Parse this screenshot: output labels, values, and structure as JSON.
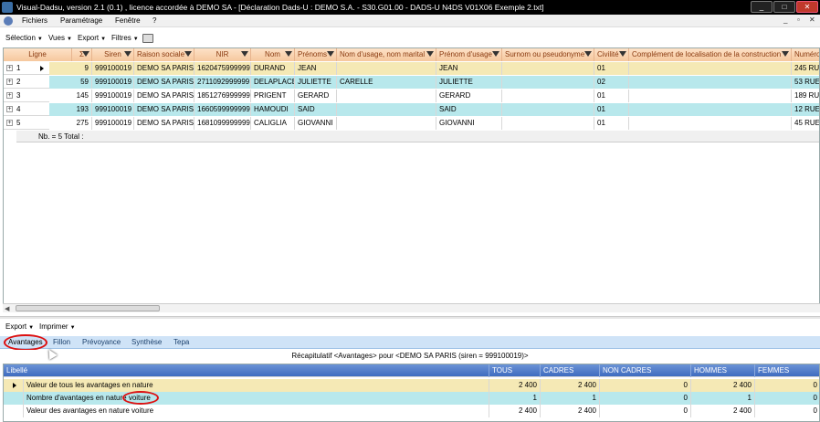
{
  "window": {
    "title": "Visual-Dadsu, version 2.1 (0.1) , licence accordée à DEMO SA - [Déclaration Dads-U : DEMO S.A. - S30.G01.00 - DADS-U N4DS V01X06 Exemple 2.txt]",
    "minimize": "_",
    "maximize": "□",
    "close": "✕"
  },
  "menu": {
    "items": [
      "Fichiers",
      "Paramétrage",
      "Fenêtre",
      "?"
    ],
    "child_controls": [
      "_",
      "▫",
      "✕"
    ]
  },
  "toolbar": {
    "items": [
      "Sélection",
      "Vues",
      "Export",
      "Filtres"
    ]
  },
  "grid": {
    "columns": [
      "Ligne",
      "Σ",
      "Siren",
      "Raison sociale",
      "NIR",
      "Nom",
      "Prénoms",
      "Nom d'usage, nom marital",
      "Prénom d'usage",
      "Surnom ou pseudonyme",
      "Civilité",
      "Complément de localisation de la construction",
      "Numéro"
    ],
    "rows": [
      {
        "ligne": "1",
        "sigma": "9",
        "siren": "999100019",
        "raison": "DEMO SA PARIS",
        "nir": "1620475999999",
        "nom": "DURAND",
        "prenoms": "JEAN",
        "nom_usage": "",
        "prenom_usage": "JEAN",
        "surnom": "",
        "civilite": "01",
        "complement": "",
        "numero": "245 RUE"
      },
      {
        "ligne": "2",
        "sigma": "59",
        "siren": "999100019",
        "raison": "DEMO SA PARIS",
        "nir": "2711092999999",
        "nom": "DELAPLACE",
        "prenoms": "JULIETTE",
        "nom_usage": "CARELLE",
        "prenom_usage": "JULIETTE",
        "surnom": "",
        "civilite": "02",
        "complement": "",
        "numero": "53 RUE"
      },
      {
        "ligne": "3",
        "sigma": "145",
        "siren": "999100019",
        "raison": "DEMO SA PARIS",
        "nir": "1851276999999",
        "nom": "PRIGENT",
        "prenoms": "GERARD",
        "nom_usage": "",
        "prenom_usage": "GERARD",
        "surnom": "",
        "civilite": "01",
        "complement": "",
        "numero": "189 RU"
      },
      {
        "ligne": "4",
        "sigma": "193",
        "siren": "999100019",
        "raison": "DEMO SA PARIS",
        "nir": "1660599999999",
        "nom": "HAMOUDI",
        "prenoms": "SAID",
        "nom_usage": "",
        "prenom_usage": "SAID",
        "surnom": "",
        "civilite": "01",
        "complement": "",
        "numero": "12 RUE"
      },
      {
        "ligne": "5",
        "sigma": "275",
        "siren": "999100019",
        "raison": "DEMO SA PARIS",
        "nir": "1681099999999",
        "nom": "CALIGLIA",
        "prenoms": "GIOVANNI",
        "nom_usage": "",
        "prenom_usage": "GIOVANNI",
        "surnom": "",
        "civilite": "01",
        "complement": "",
        "numero": "45 RUE"
      }
    ],
    "summary": "Nb. =    5 Total :"
  },
  "lower_toolbar": {
    "items": [
      "Export",
      "Imprimer"
    ]
  },
  "tabs": [
    "Avantages",
    "Fillon",
    "Prévoyance",
    "Synthèse",
    "Tepa"
  ],
  "recap_title": "Récapitulatif <Avantages> pour <DEMO SA PARIS (siren = 999100019)>",
  "lower_grid": {
    "columns": [
      "Libellé",
      "TOUS",
      "CADRES",
      "NON CADRES",
      "HOMMES",
      "FEMMES"
    ],
    "rows": [
      {
        "libelle": "Valeur de tous les avantages en nature",
        "tous": "2 400",
        "cadres": "2 400",
        "non_cadres": "0",
        "hommes": "2 400",
        "femmes": "0"
      },
      {
        "libelle": "Nombre d'avantages en nature voiture",
        "tous": "1",
        "cadres": "1",
        "non_cadres": "0",
        "hommes": "1",
        "femmes": "0"
      },
      {
        "libelle": "Valeur des avantages en nature voiture",
        "tous": "2 400",
        "cadres": "2 400",
        "non_cadres": "0",
        "hommes": "2 400",
        "femmes": "0"
      }
    ]
  },
  "colors": {
    "header_orange": "#f6c79d",
    "row_yellow": "#f5e9b5",
    "row_cyan": "#b8e8ec",
    "lower_header_blue": "#3e6bbf",
    "tab_bar_blue": "#cfe3f7",
    "annotation_red": "#d11111"
  },
  "icons": [
    "app-icon",
    "printer-icon",
    "filter-icon",
    "expand-icon",
    "row-pointer-icon",
    "mouse-cursor-icon"
  ]
}
